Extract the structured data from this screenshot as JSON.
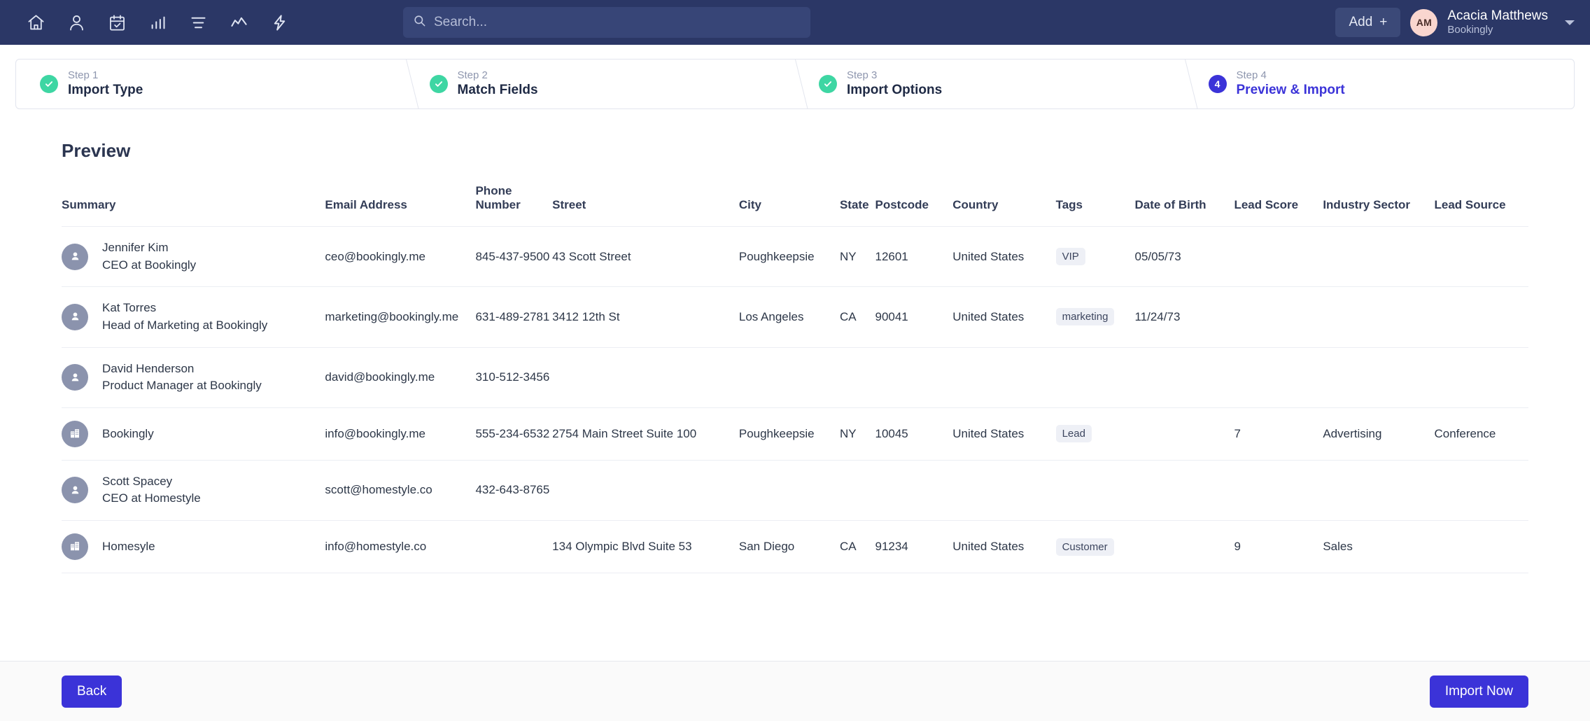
{
  "topnav": {
    "icons": [
      {
        "name": "home-icon",
        "label": "Home"
      },
      {
        "name": "person-icon",
        "label": "Contacts"
      },
      {
        "name": "calendar-check-icon",
        "label": "Calendar"
      },
      {
        "name": "bar-chart-icon",
        "label": "Reports"
      },
      {
        "name": "list-icon",
        "label": "Tasks"
      },
      {
        "name": "activity-line-icon",
        "label": "Activity"
      },
      {
        "name": "lightning-bolt-icon",
        "label": "Automations"
      }
    ],
    "search": {
      "placeholder": "Search...",
      "value": ""
    },
    "add_label": "Add",
    "add_plus": "+",
    "user": {
      "initials": "AM",
      "name": "Acacia Matthews",
      "org": "Bookingly"
    }
  },
  "stepper": {
    "steps": [
      {
        "num": "Step 1",
        "title": "Import Type",
        "state": "done",
        "badge": ""
      },
      {
        "num": "Step 2",
        "title": "Match Fields",
        "state": "done",
        "badge": ""
      },
      {
        "num": "Step 3",
        "title": "Import Options",
        "state": "done",
        "badge": ""
      },
      {
        "num": "Step 4",
        "title": "Preview & Import",
        "state": "current",
        "badge": "4"
      }
    ]
  },
  "main": {
    "title": "Preview",
    "columns": [
      "Summary",
      "Email Address",
      "Phone Number",
      "Street",
      "City",
      "State",
      "Postcode",
      "Country",
      "Tags",
      "Date of Birth",
      "Lead Score",
      "Industry Sector",
      "Lead Source"
    ],
    "rows": [
      {
        "avatar": "person-icon",
        "primary": "Jennifer Kim",
        "secondary": "CEO at Bookingly",
        "email": "ceo@bookingly.me",
        "phone": "845-437-9500",
        "street": "43 Scott Street",
        "city": "Poughkeepsie",
        "state": "NY",
        "postcode": "12601",
        "country": "United States",
        "tag": "VIP",
        "dob": "05/05/73",
        "lead_score": "",
        "industry": "",
        "lead_source": ""
      },
      {
        "avatar": "person-icon",
        "primary": "Kat Torres",
        "secondary": "Head of Marketing at Bookingly",
        "email": "marketing@bookingly.me",
        "phone": "631-489-2781",
        "street": "3412 12th St",
        "city": "Los Angeles",
        "state": "CA",
        "postcode": "90041",
        "country": "United States",
        "tag": "marketing",
        "dob": "11/24/73",
        "lead_score": "",
        "industry": "",
        "lead_source": ""
      },
      {
        "avatar": "person-icon",
        "primary": "David Henderson",
        "secondary": "Product Manager at Bookingly",
        "email": "david@bookingly.me",
        "phone": "310-512-3456",
        "street": "",
        "city": "",
        "state": "",
        "postcode": "",
        "country": "",
        "tag": "",
        "dob": "",
        "lead_score": "",
        "industry": "",
        "lead_source": ""
      },
      {
        "avatar": "building-icon",
        "primary": "Bookingly",
        "secondary": "",
        "email": "info@bookingly.me",
        "phone": "555-234-6532",
        "street": "2754 Main Street Suite 100",
        "city": "Poughkeepsie",
        "state": "NY",
        "postcode": "10045",
        "country": "United States",
        "tag": "Lead",
        "dob": "",
        "lead_score": "7",
        "industry": "Advertising",
        "lead_source": "Conference"
      },
      {
        "avatar": "person-icon",
        "primary": "Scott Spacey",
        "secondary": "CEO at Homestyle",
        "email": "scott@homestyle.co",
        "phone": "432-643-8765",
        "street": "",
        "city": "",
        "state": "",
        "postcode": "",
        "country": "",
        "tag": "",
        "dob": "",
        "lead_score": "",
        "industry": "",
        "lead_source": ""
      },
      {
        "avatar": "building-icon",
        "primary": "Homesyle",
        "secondary": "",
        "email": "info@homestyle.co",
        "phone": "",
        "street": "134 Olympic Blvd Suite 53",
        "city": "San Diego",
        "state": "CA",
        "postcode": "91234",
        "country": "United States",
        "tag": "Customer",
        "dob": "",
        "lead_score": "9",
        "industry": "Sales",
        "lead_source": ""
      }
    ]
  },
  "footer": {
    "back_label": "Back",
    "import_label": "Import Now"
  },
  "colors": {
    "nav_bg": "#2b3766",
    "accent": "#3b33d8",
    "success": "#3ed6a3",
    "avatar": "#8b93ad",
    "chip_bg": "#eef0f6"
  }
}
